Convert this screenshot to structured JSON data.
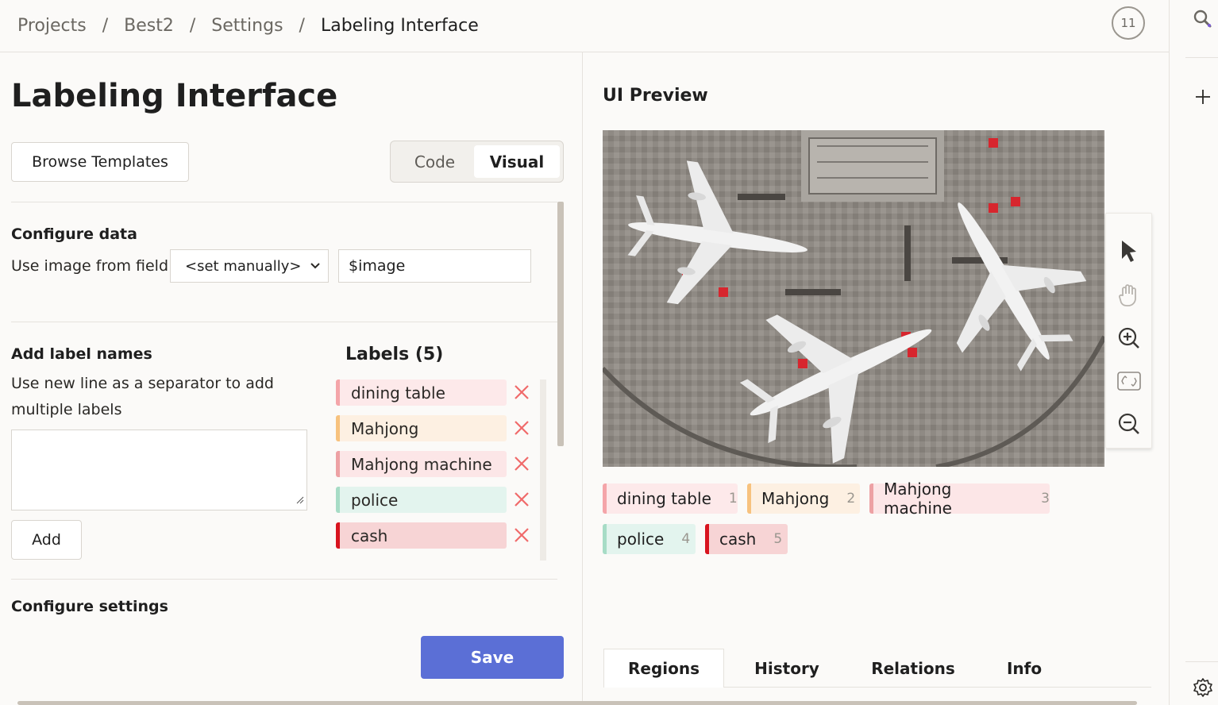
{
  "breadcrumb": {
    "items": [
      "Projects",
      "Best2",
      "Settings",
      "Labeling Interface"
    ],
    "separator": "/"
  },
  "header": {
    "notification_count": "11"
  },
  "page": {
    "title": "Labeling Interface",
    "browse_templates": "Browse Templates",
    "mode_tabs": {
      "code": "Code",
      "visual": "Visual",
      "active": "Visual"
    }
  },
  "configure_data": {
    "title": "Configure data",
    "field_label": "Use image from field",
    "select_value": "<set manually>",
    "input_value": "$image"
  },
  "add_labels": {
    "title": "Add label names",
    "help_text": "Use new line as a separator to add multiple labels",
    "textarea_value": "",
    "add_button": "Add"
  },
  "labels": {
    "title": "Labels (5)",
    "items": [
      {
        "name": "dining table",
        "bg": "#fde9ea",
        "border": "#f4a5a9"
      },
      {
        "name": "Mahjong",
        "bg": "#fdf0e2",
        "border": "#f7c27e"
      },
      {
        "name": "Mahjong machine",
        "bg": "#fce6e7",
        "border": "#eda1a4"
      },
      {
        "name": "police",
        "bg": "#e3f4ee",
        "border": "#a7dcc6"
      },
      {
        "name": "cash",
        "bg": "#f7d4d5",
        "border": "#d8141f"
      }
    ]
  },
  "configure_settings": {
    "title": "Configure settings"
  },
  "save_button": "Save",
  "preview": {
    "title": "UI Preview",
    "chips": [
      {
        "name": "dining table",
        "hotkey": "1"
      },
      {
        "name": "Mahjong",
        "hotkey": "2"
      },
      {
        "name": "Mahjong machine",
        "hotkey": "3"
      },
      {
        "name": "police",
        "hotkey": "4"
      },
      {
        "name": "cash",
        "hotkey": "5"
      }
    ],
    "tabs": [
      "Regions",
      "History",
      "Relations",
      "Info"
    ],
    "active_tab": "Regions",
    "tools": [
      "pointer-icon",
      "hand-icon",
      "zoom-in-icon",
      "fit-screen-icon",
      "zoom-out-icon"
    ]
  },
  "colors": {
    "accent": "#5b6fd6",
    "delete": "#f06a6a"
  }
}
